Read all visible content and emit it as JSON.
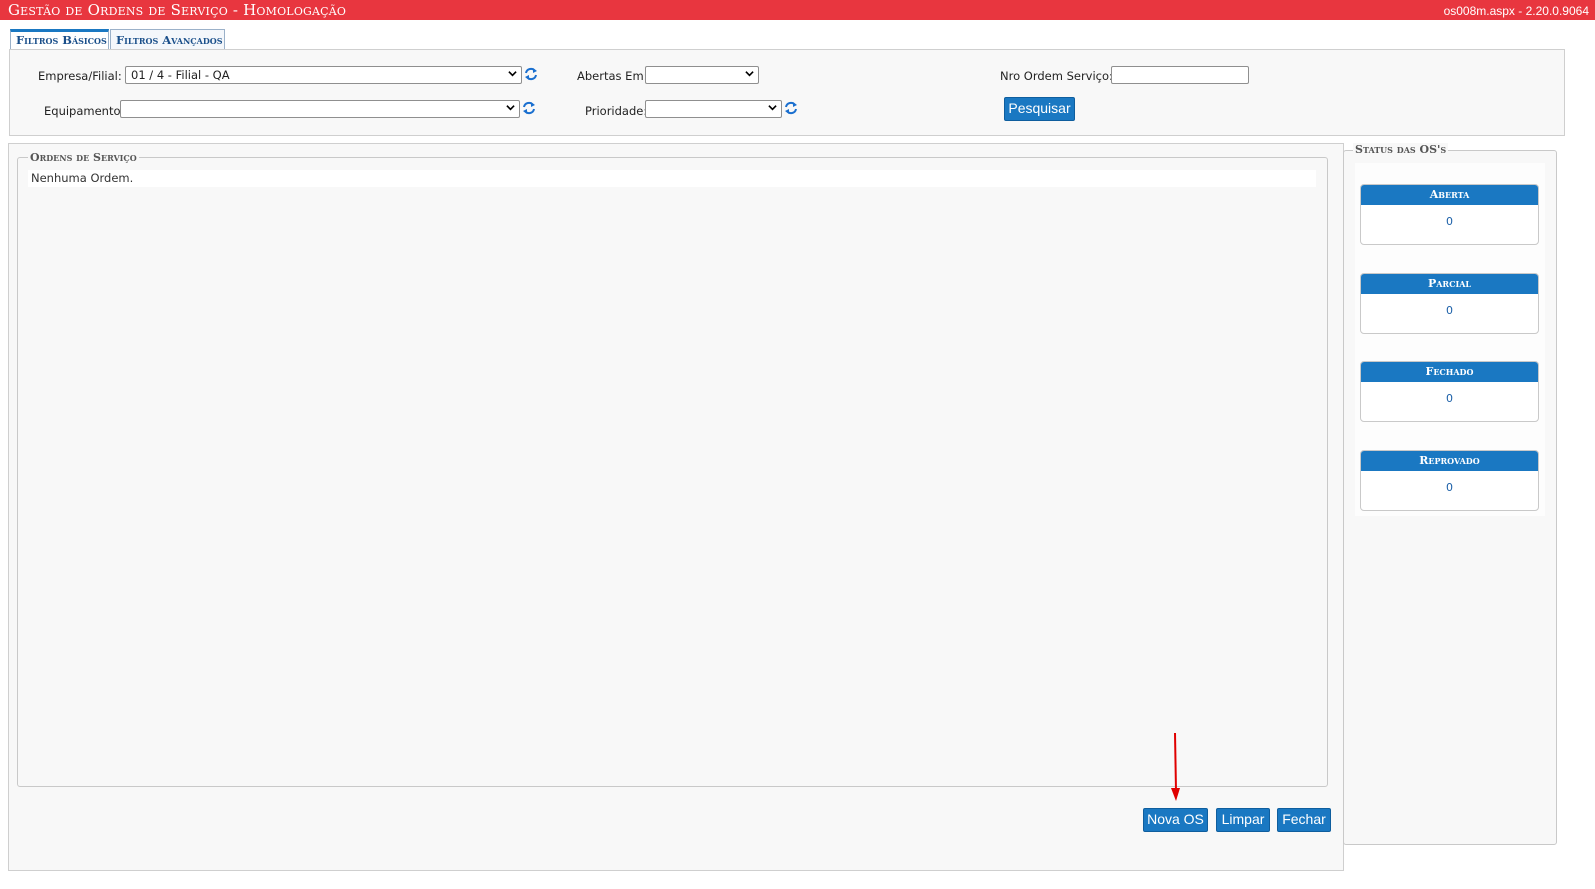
{
  "header": {
    "title": "Gestão de Ordens de Serviço  - Homologação",
    "version": "os008m.aspx - 2.20.0.9064"
  },
  "tabs": [
    {
      "label": "Filtros Básicos",
      "active": true
    },
    {
      "label": "Filtros Avançados",
      "active": false
    }
  ],
  "filters": {
    "empresa_label": "Empresa/Filial:",
    "empresa_value": "01 / 4 - Filial - QA",
    "equipamento_label": "Equipamento:",
    "equipamento_value": "",
    "abertas_label": "Abertas Em:",
    "abertas_value": "",
    "prioridade_label": "Prioridade:",
    "prioridade_value": "",
    "nro_label": "Nro Ordem Serviço:",
    "nro_value": "",
    "search_button": "Pesquisar"
  },
  "orders": {
    "legend": "Ordens de Serviço",
    "empty_text": "Nenhuma Ordem."
  },
  "actions": {
    "new_label": "Nova OS",
    "clear_label": "Limpar",
    "close_label": "Fechar"
  },
  "status": {
    "legend": "Status das OS's",
    "cards": [
      {
        "label": "Aberta",
        "value": "0"
      },
      {
        "label": "Parcial",
        "value": "0"
      },
      {
        "label": "Fechado",
        "value": "0"
      },
      {
        "label": "Reprovado",
        "value": "0"
      }
    ]
  },
  "colors": {
    "header_bg": "#e8363f",
    "accent": "#1a78c2",
    "annotation_arrow": "#e00000"
  }
}
